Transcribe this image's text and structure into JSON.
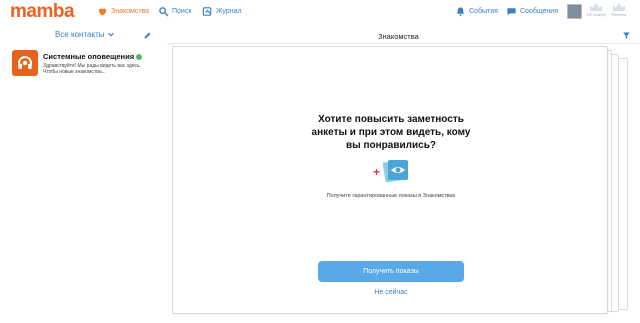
{
  "header": {
    "logo": "mamba",
    "nav": {
      "dating": "Знакомства",
      "search": "Поиск",
      "journal": "Журнал",
      "events": "События",
      "messages": "Сообщения"
    },
    "crowns": [
      "VIP-статус",
      "Рейтинг"
    ]
  },
  "sidebar": {
    "contacts_filter": "Все контакты",
    "notification": {
      "title": "Системные оповещения",
      "preview": "Здравствуйте! Мы рады видеть вас здесь. Чтобы новые знакомства..."
    }
  },
  "main": {
    "title": "Знакомства",
    "headline": [
      "Хотите повысить заметность",
      "анкеты и при этом видеть, кому",
      "вы понравились?"
    ],
    "description": "Получите гарантированные показы в Знакомствах",
    "cta_label": "Получить показы",
    "later_label": "Не сейчас"
  },
  "colors": {
    "brand": "#f0601f",
    "link": "#3d7fc1",
    "button": "#59a9e6",
    "online": "#52b96a"
  }
}
